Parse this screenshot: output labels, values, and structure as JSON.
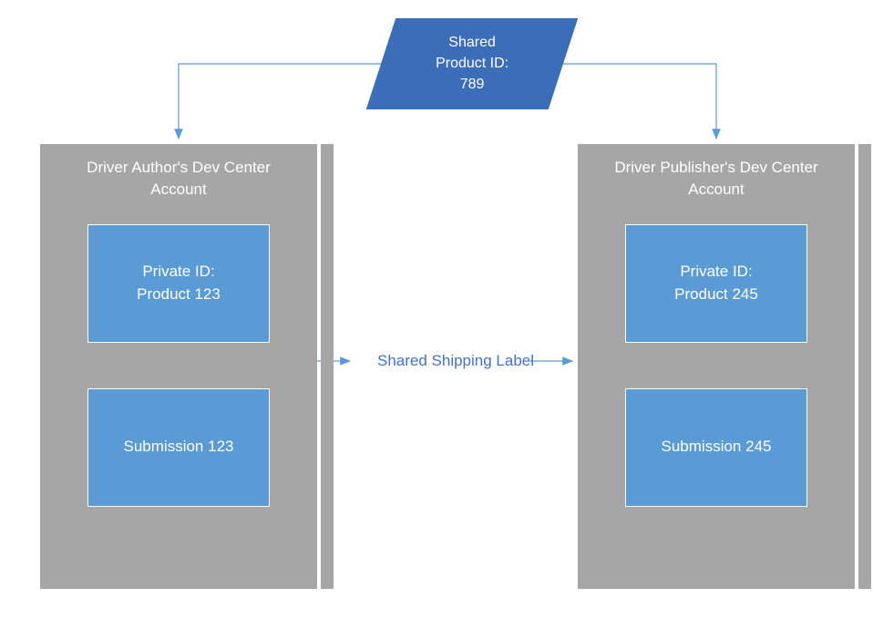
{
  "shared_product": {
    "line1": "Shared",
    "line2": "Product ID:",
    "line3": "789"
  },
  "accounts": {
    "author": {
      "title_line1": "Driver Author's Dev Center",
      "title_line2": "Account",
      "private_id_line1": "Private ID:",
      "private_id_line2": "Product 123",
      "submission": "Submission 123"
    },
    "publisher": {
      "title_line1": "Driver Publisher's Dev Center",
      "title_line2": "Account",
      "private_id_line1": "Private ID:",
      "private_id_line2": "Product 245",
      "submission": "Submission 245"
    }
  },
  "connector_label": "Shared Shipping Label",
  "colors": {
    "shared_product_bg": "#3b6db8",
    "account_bg": "#a6a6a6",
    "sub_block_bg": "#5b9bd5",
    "arrow": "#5b9bd5"
  }
}
